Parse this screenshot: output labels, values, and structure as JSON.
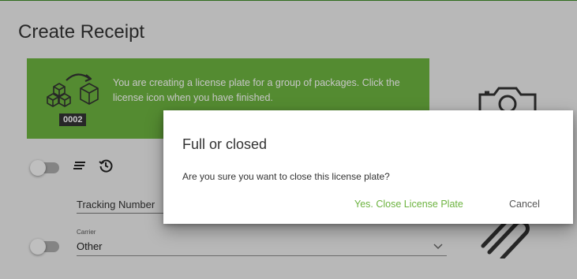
{
  "page": {
    "title": "Create Receipt"
  },
  "header": {
    "search_fragment": ""
  },
  "banner": {
    "message": "You are creating a license plate for a group of packages. Click the license icon when you have finished.",
    "plate_number": "0002",
    "icon": "package-group-icon",
    "color": "#6cb33f"
  },
  "form": {
    "tracking_label": "Tracking Number",
    "carrier_label": "Carrier",
    "carrier_value": "Other"
  },
  "dialog": {
    "title": "Full or closed",
    "message": "Are you sure you want to close this license plate?",
    "confirm_label": "Yes. Close License Plate",
    "cancel_label": "Cancel",
    "accent": "#6cb33f"
  },
  "icons": [
    "camera-icon",
    "attachment-icon",
    "list-icon",
    "history-icon",
    "chevron-down-icon"
  ]
}
